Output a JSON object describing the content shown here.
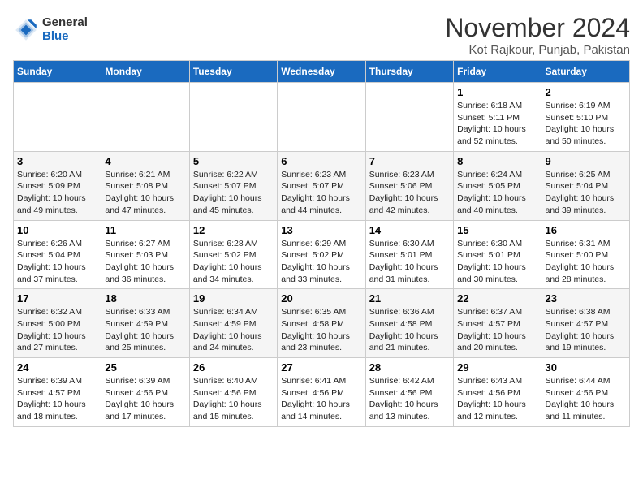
{
  "logo": {
    "general": "General",
    "blue": "Blue"
  },
  "title": "November 2024",
  "location": "Kot Rajkour, Punjab, Pakistan",
  "headers": [
    "Sunday",
    "Monday",
    "Tuesday",
    "Wednesday",
    "Thursday",
    "Friday",
    "Saturday"
  ],
  "weeks": [
    [
      {
        "day": "",
        "info": ""
      },
      {
        "day": "",
        "info": ""
      },
      {
        "day": "",
        "info": ""
      },
      {
        "day": "",
        "info": ""
      },
      {
        "day": "",
        "info": ""
      },
      {
        "day": "1",
        "info": "Sunrise: 6:18 AM\nSunset: 5:11 PM\nDaylight: 10 hours\nand 52 minutes."
      },
      {
        "day": "2",
        "info": "Sunrise: 6:19 AM\nSunset: 5:10 PM\nDaylight: 10 hours\nand 50 minutes."
      }
    ],
    [
      {
        "day": "3",
        "info": "Sunrise: 6:20 AM\nSunset: 5:09 PM\nDaylight: 10 hours\nand 49 minutes."
      },
      {
        "day": "4",
        "info": "Sunrise: 6:21 AM\nSunset: 5:08 PM\nDaylight: 10 hours\nand 47 minutes."
      },
      {
        "day": "5",
        "info": "Sunrise: 6:22 AM\nSunset: 5:07 PM\nDaylight: 10 hours\nand 45 minutes."
      },
      {
        "day": "6",
        "info": "Sunrise: 6:23 AM\nSunset: 5:07 PM\nDaylight: 10 hours\nand 44 minutes."
      },
      {
        "day": "7",
        "info": "Sunrise: 6:23 AM\nSunset: 5:06 PM\nDaylight: 10 hours\nand 42 minutes."
      },
      {
        "day": "8",
        "info": "Sunrise: 6:24 AM\nSunset: 5:05 PM\nDaylight: 10 hours\nand 40 minutes."
      },
      {
        "day": "9",
        "info": "Sunrise: 6:25 AM\nSunset: 5:04 PM\nDaylight: 10 hours\nand 39 minutes."
      }
    ],
    [
      {
        "day": "10",
        "info": "Sunrise: 6:26 AM\nSunset: 5:04 PM\nDaylight: 10 hours\nand 37 minutes."
      },
      {
        "day": "11",
        "info": "Sunrise: 6:27 AM\nSunset: 5:03 PM\nDaylight: 10 hours\nand 36 minutes."
      },
      {
        "day": "12",
        "info": "Sunrise: 6:28 AM\nSunset: 5:02 PM\nDaylight: 10 hours\nand 34 minutes."
      },
      {
        "day": "13",
        "info": "Sunrise: 6:29 AM\nSunset: 5:02 PM\nDaylight: 10 hours\nand 33 minutes."
      },
      {
        "day": "14",
        "info": "Sunrise: 6:30 AM\nSunset: 5:01 PM\nDaylight: 10 hours\nand 31 minutes."
      },
      {
        "day": "15",
        "info": "Sunrise: 6:30 AM\nSunset: 5:01 PM\nDaylight: 10 hours\nand 30 minutes."
      },
      {
        "day": "16",
        "info": "Sunrise: 6:31 AM\nSunset: 5:00 PM\nDaylight: 10 hours\nand 28 minutes."
      }
    ],
    [
      {
        "day": "17",
        "info": "Sunrise: 6:32 AM\nSunset: 5:00 PM\nDaylight: 10 hours\nand 27 minutes."
      },
      {
        "day": "18",
        "info": "Sunrise: 6:33 AM\nSunset: 4:59 PM\nDaylight: 10 hours\nand 25 minutes."
      },
      {
        "day": "19",
        "info": "Sunrise: 6:34 AM\nSunset: 4:59 PM\nDaylight: 10 hours\nand 24 minutes."
      },
      {
        "day": "20",
        "info": "Sunrise: 6:35 AM\nSunset: 4:58 PM\nDaylight: 10 hours\nand 23 minutes."
      },
      {
        "day": "21",
        "info": "Sunrise: 6:36 AM\nSunset: 4:58 PM\nDaylight: 10 hours\nand 21 minutes."
      },
      {
        "day": "22",
        "info": "Sunrise: 6:37 AM\nSunset: 4:57 PM\nDaylight: 10 hours\nand 20 minutes."
      },
      {
        "day": "23",
        "info": "Sunrise: 6:38 AM\nSunset: 4:57 PM\nDaylight: 10 hours\nand 19 minutes."
      }
    ],
    [
      {
        "day": "24",
        "info": "Sunrise: 6:39 AM\nSunset: 4:57 PM\nDaylight: 10 hours\nand 18 minutes."
      },
      {
        "day": "25",
        "info": "Sunrise: 6:39 AM\nSunset: 4:56 PM\nDaylight: 10 hours\nand 17 minutes."
      },
      {
        "day": "26",
        "info": "Sunrise: 6:40 AM\nSunset: 4:56 PM\nDaylight: 10 hours\nand 15 minutes."
      },
      {
        "day": "27",
        "info": "Sunrise: 6:41 AM\nSunset: 4:56 PM\nDaylight: 10 hours\nand 14 minutes."
      },
      {
        "day": "28",
        "info": "Sunrise: 6:42 AM\nSunset: 4:56 PM\nDaylight: 10 hours\nand 13 minutes."
      },
      {
        "day": "29",
        "info": "Sunrise: 6:43 AM\nSunset: 4:56 PM\nDaylight: 10 hours\nand 12 minutes."
      },
      {
        "day": "30",
        "info": "Sunrise: 6:44 AM\nSunset: 4:56 PM\nDaylight: 10 hours\nand 11 minutes."
      }
    ]
  ]
}
